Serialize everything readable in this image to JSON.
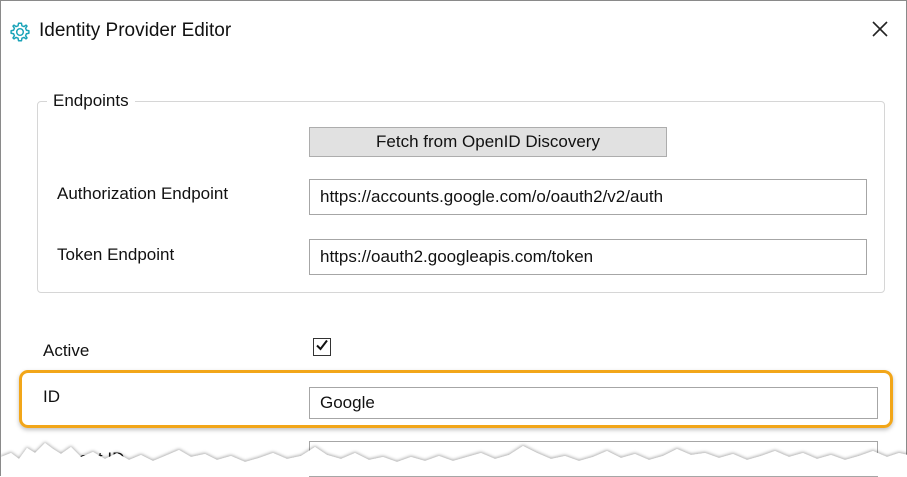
{
  "window": {
    "title": "Identity Provider Editor",
    "icon": "gear-icon",
    "close_icon": "close-icon"
  },
  "endpoints": {
    "group_title": "Endpoints",
    "fetch_button_label": "Fetch from OpenID Discovery",
    "authorization_label": "Authorization Endpoint",
    "authorization_value": "https://accounts.google.com/o/oauth2/v2/auth",
    "token_label": "Token Endpoint",
    "token_value": "https://oauth2.googleapis.com/token"
  },
  "fields": {
    "active_label": "Active",
    "active_checked": true,
    "id_label": "ID",
    "id_value": "Google",
    "client_id_label_partial": "ent ID"
  },
  "colors": {
    "highlight": "#f2a619",
    "icon_teal": "#1aa3b8"
  }
}
